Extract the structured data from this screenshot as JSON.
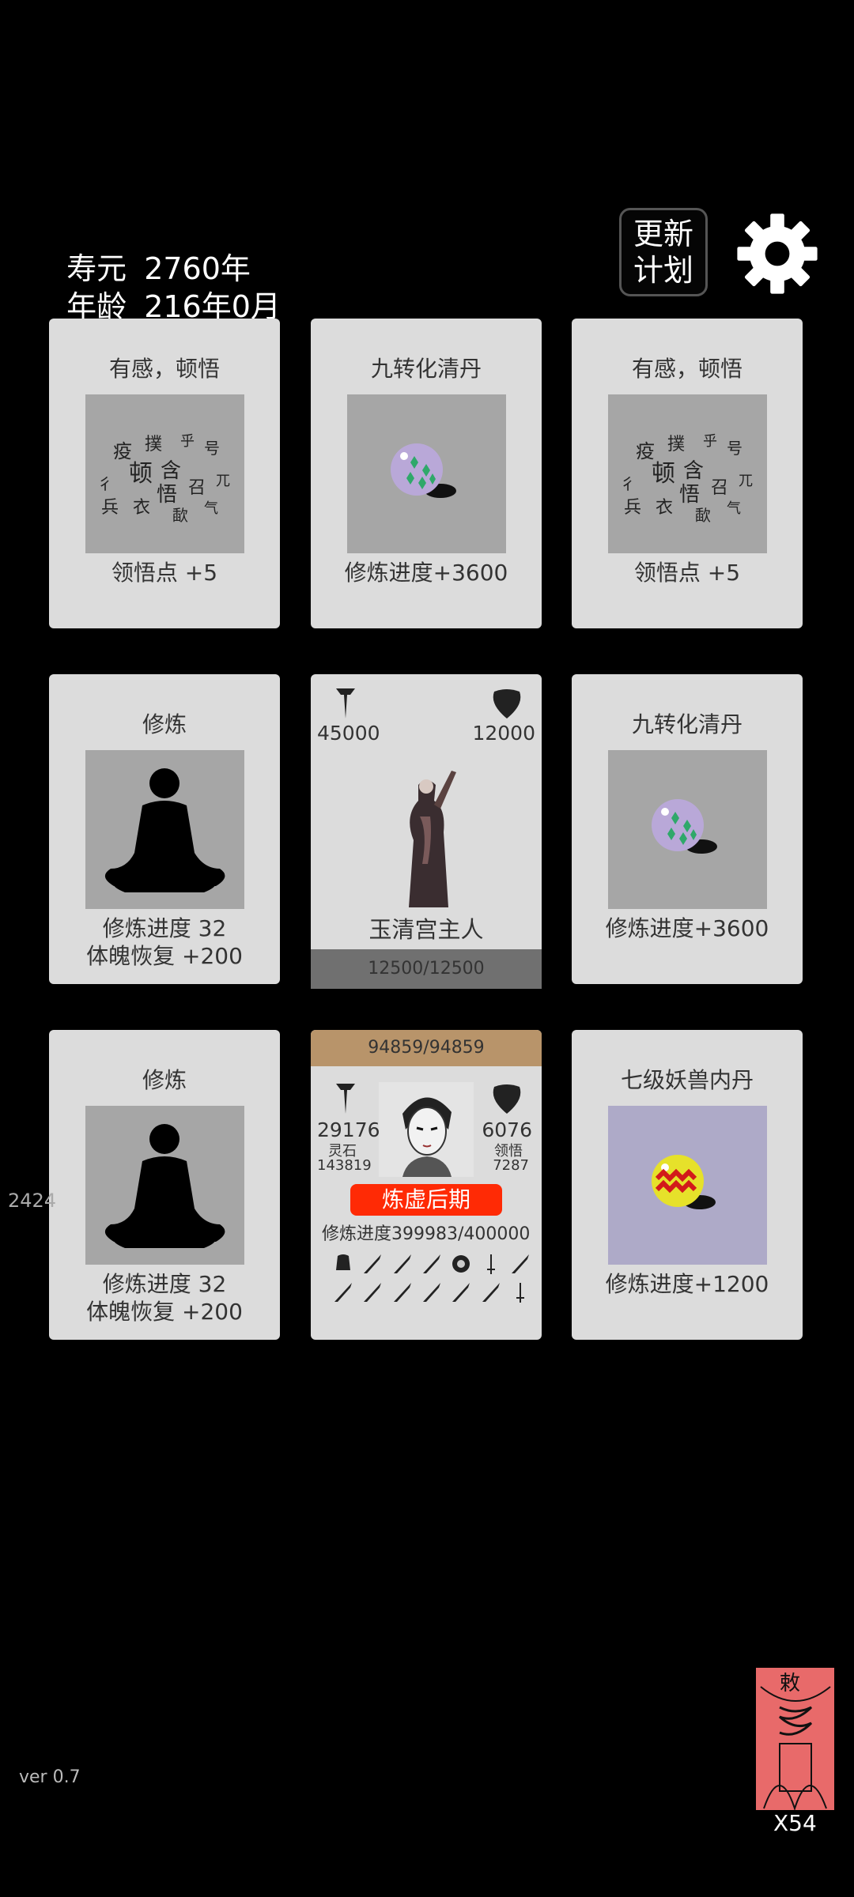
{
  "status": {
    "lifespan_label": "寿元",
    "lifespan_value": "2760年",
    "age_label": "年龄",
    "age_value": "216年0月"
  },
  "header": {
    "update_plan_line1": "更新",
    "update_plan_line2": "计划",
    "settings_icon": "gear-icon"
  },
  "cards": {
    "c1": {
      "title": "有感，顿悟",
      "effect": "领悟点  +5",
      "icon": "calligraphy"
    },
    "c2": {
      "title": "九转化清丹",
      "effect": "修炼进度+3600",
      "icon": "purple-pill"
    },
    "c3": {
      "title": "有感，顿悟",
      "effect": "领悟点  +5",
      "icon": "calligraphy"
    },
    "c4": {
      "title": "修炼",
      "effect1": "修炼进度  32",
      "effect2": "体魄恢复  +200",
      "icon": "meditation"
    },
    "boss": {
      "attack": "45000",
      "defense": "12000",
      "name": "玉清宫主人",
      "hp": "12500/12500"
    },
    "c6": {
      "title": "九转化清丹",
      "effect": "修炼进度+3600",
      "icon": "purple-pill"
    },
    "c7": {
      "title": "修炼",
      "effect1": "修炼进度  32",
      "effect2": "体魄恢复  +200",
      "icon": "meditation"
    },
    "player": {
      "hp": "94859/94859",
      "attack": "29176",
      "defense": "6076",
      "spirit_stone_label": "灵石",
      "spirit_stone_value": "143819",
      "insight_label": "领悟",
      "insight_value": "7287",
      "realm": "炼虚后期",
      "progress_label": "修炼进度",
      "progress_value": "399983/400000"
    },
    "c9": {
      "title": "七级妖兽内丹",
      "effect": "修炼进度+1200",
      "icon": "yellow-core"
    }
  },
  "side_number": "2424",
  "footer": {
    "version": "ver 0.7",
    "talisman_count": "X54",
    "talisman_text": "敕"
  },
  "colors": {
    "background": "#000000",
    "card": "#dcdcdc",
    "art_gray": "#a6a6a6",
    "art_lavender": "#aeaac8",
    "boss_bar": "#707070",
    "player_bar": "#b8946a",
    "realm_red": "#ff2a05",
    "talisman": "#e86a6a"
  }
}
